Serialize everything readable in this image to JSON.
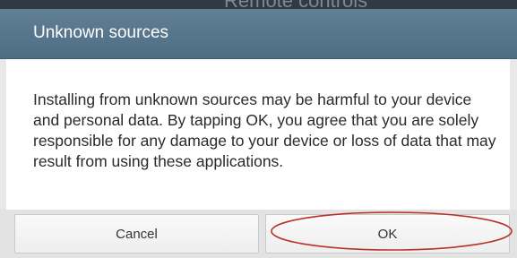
{
  "background": {
    "partial_text": "Remote controls"
  },
  "dialog": {
    "title": "Unknown sources",
    "message": "Installing from unknown sources may be harmful to your device and personal data. By tapping OK, you agree that you are solely responsible for any damage to your device or loss of data that may result from using these applications.",
    "buttons": {
      "cancel_label": "Cancel",
      "ok_label": "OK"
    }
  },
  "colors": {
    "header": "#5a788e",
    "highlight_ellipse": "#b8322a"
  }
}
